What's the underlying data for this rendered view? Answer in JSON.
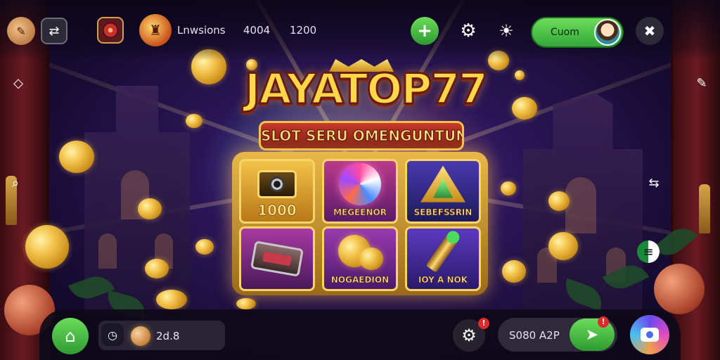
{
  "header": {
    "player_name": "Lnwsions",
    "stat_a": "4004",
    "stat_b": "1200"
  },
  "login": {
    "label": "Cuom"
  },
  "logo": {
    "title": "JAYATOP77",
    "subtitle": "SLOT SERU OMENGUNTUNGAN"
  },
  "tiles": [
    {
      "label": "1000",
      "art": "camera-box-icon"
    },
    {
      "label": "MEGEENOR",
      "art": "swirl-orb-icon"
    },
    {
      "label": "SEBEFSSRIN",
      "art": "triangle-gem-icon"
    },
    {
      "label": "",
      "art": "battery-box-icon"
    },
    {
      "label": "NOGAEDION",
      "art": "gold-coins-icon"
    },
    {
      "label": "IOY A NOK",
      "art": "bullet-icon"
    }
  ],
  "bottom": {
    "balance": "2d.8",
    "bet": "S080 A2P",
    "settings_badge": "!",
    "spin_badge": "!"
  },
  "colors": {
    "accent_green": "#4cc24a",
    "gold": "#f2c24a",
    "logo_red": "#c83a2a",
    "badge_red": "#e02a2a"
  }
}
